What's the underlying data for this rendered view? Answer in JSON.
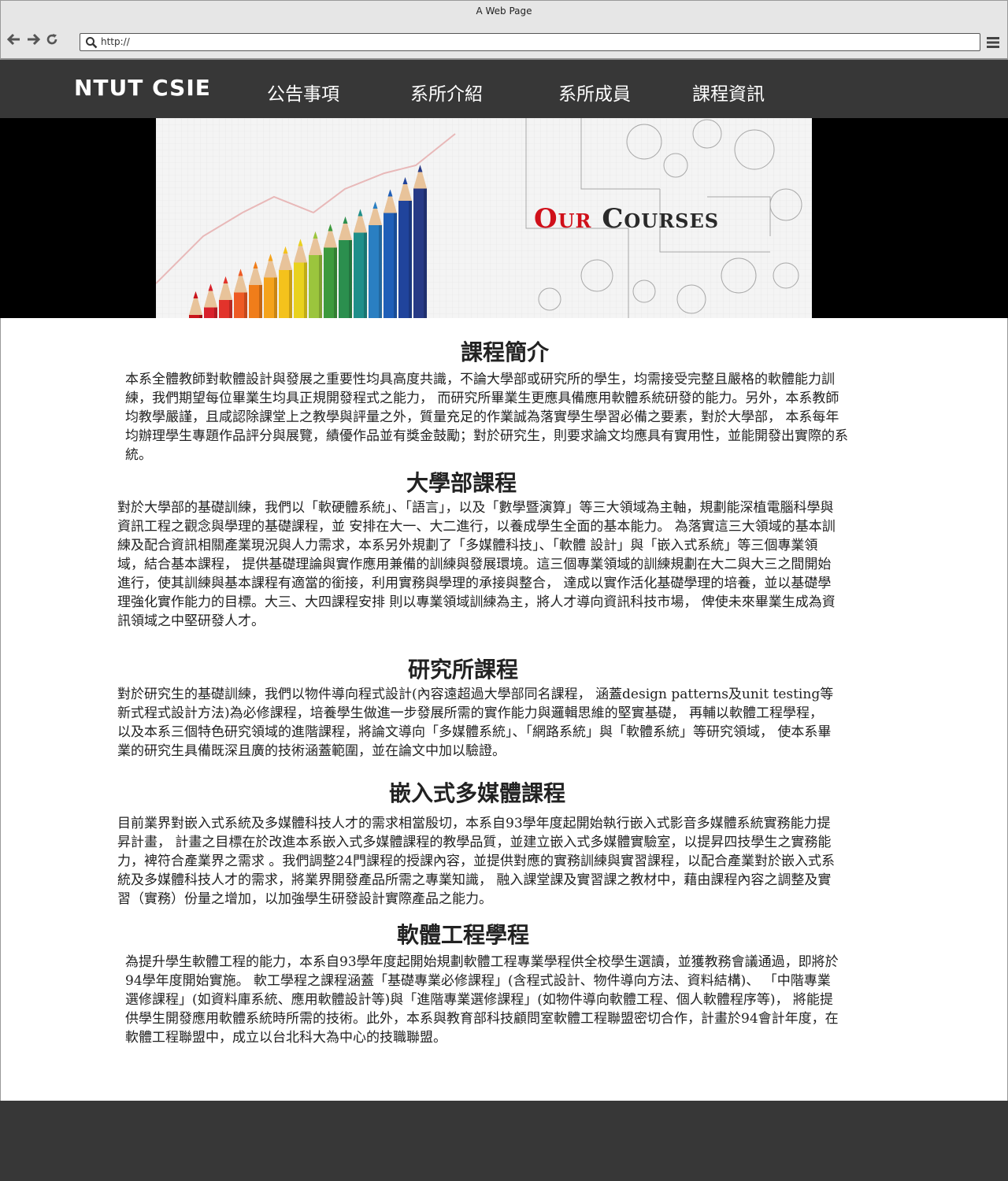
{
  "browser": {
    "window_title": "A Web Page",
    "url": "http://"
  },
  "header": {
    "logo": "NTUT CSIE",
    "menu": [
      "公告事項",
      "系所介紹",
      "系所成員",
      "課程資訊"
    ]
  },
  "banner": {
    "title_part1": "Our",
    "title_part2": "Courses",
    "accent_color": "#d0101a"
  },
  "sections": [
    {
      "title": "課程簡介",
      "body": "本系全體教師對軟體設計與發展之重要性均具高度共識，不論大學部或研究所的學生，均需接受完整且嚴格的軟體能力訓練，我們期望每位畢業生均具正規開發程式之能力， 而研究所畢業生更應具備應用軟體系統研發的能力。另外，本系教師均教學嚴謹，且咸認除課堂上之教學與評量之外，質量充足的作業誠為落實學生學習必備之要素，對於大學部， 本系每年均辦理學生專題作品評分與展覽，績優作品並有獎金鼓勵；對於研究生，則要求論文均應具有實用性，並能開發出實際的系統。"
    },
    {
      "title": "大學部課程",
      "body": "對於大學部的基礎訓練，我們以「軟硬體系統」、「語言」，以及「數學暨演算」等三大領域為主軸，規劃能深植電腦科學與資訊工程之觀念與學理的基礎課程，並 安排在大一、大二進行，以養成學生全面的基本能力。 為落實這三大領域的基本訓練及配合資訊相關產業現況與人力需求，本系另外規劃了「多媒體科技」、「軟體 設計」與「嵌入式系統」等三個專業領域，結合基本課程， 提供基礎理論與實作應用兼備的訓練與發展環境。這三個專業領域的訓練規劃在大二與大三之間開始進行，使其訓練與基本課程有適當的銜接，利用實務與學理的承接與整合， 達成以實作活化基礎學理的培養，並以基礎學理強化實作能力的目標。大三、大四課程安排 則以專業領域訓練為主，將人才導向資訊科技市場， 俾使未來畢業生成為資訊領域之中堅研發人才。"
    },
    {
      "title": "研究所課程",
      "body": "對於研究生的基礎訓練，我們以物件導向程式設計(內容遠超過大學部同名課程， 涵蓋design patterns及unit testing等新式程式設計方法)為必修課程，培養學生做進一步發展所需的實作能力與邏輯思維的堅實基礎， 再輔以軟體工程學程，以及本系三個特色研究領域的進階課程，將論文導向「多媒體系統」、「網路系統」與「軟體系統」等研究領域， 使本系畢業的研究生具備既深且廣的技術涵蓋範圍，並在論文中加以驗證。"
    },
    {
      "title": "嵌入式多媒體課程",
      "body": "目前業界對嵌入式系統及多媒體科技人才的需求相當殷切，本系自93學年度起開始執行嵌入式影音多媒體系統實務能力提昇計畫， 計畫之目標在於改進本系嵌入式多媒體課程的教學品質，並建立嵌入式多媒體實驗室，以提昇四技學生之實務能力，裨符合產業界之需求 。我們調整24門課程的授課內容，並提供對應的實務訓練與實習課程，以配合產業對於嵌入式系統及多媒體科技人才的需求，將業界開發產品所需之專業知識， 融入課堂課及實習課之教材中，藉由課程內容之調整及實習（實務）份量之增加，以加強學生研發設計實際產品之能力。"
    },
    {
      "title": "軟體工程學程",
      "body": "為提升學生軟體工程的能力，本系自93學年度起開始規劃軟體工程專業學程供全校學生選讀，並獲教務會議通過，即將於94學年度開始實施。 軟工學程之課程涵蓋「基礎專業必修課程」(含程式設計、物件導向方法、資料結構)、 「中階專業選修課程」(如資料庫系統、應用軟體設計等)與「進階專業選修課程」(如物件導向軟體工程、個人軟體程序等)， 將能提供學生開發應用軟體系統時所需的技術。此外，本系與教育部科技顧問室軟體工程聯盟密切合作，計畫於94會計年度，在軟體工程聯盟中，成立以台北科大為中心的技職聯盟。"
    }
  ]
}
